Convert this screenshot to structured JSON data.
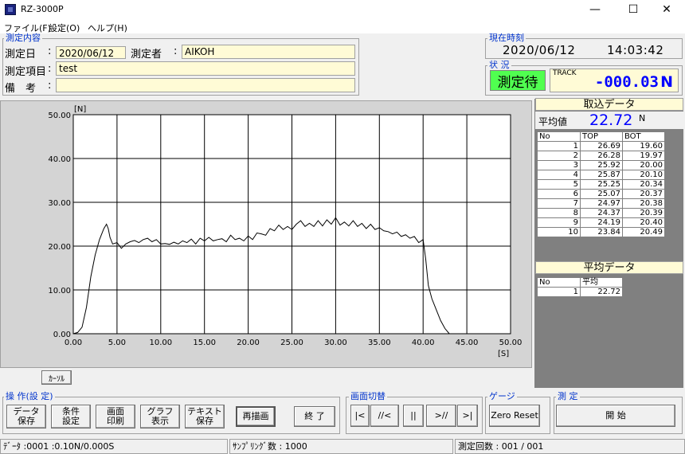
{
  "window": {
    "title": "RZ-3000P",
    "minimize": "—",
    "maximize": "☐",
    "close": "✕"
  },
  "menu": [
    "ファイル(F)",
    "設定(O)",
    "ヘルプ(H)"
  ],
  "measurement": {
    "group_label": "測定内容",
    "date_label": "測定日",
    "date_value": "2020/06/12",
    "operator_label": "測定者",
    "operator_value": "AIKOH",
    "item_label": "測定項目",
    "item_value": "test",
    "remarks_label": "備　考",
    "remarks_value": "",
    "colon": ":"
  },
  "clock": {
    "group_label": "現在時刻",
    "date": "2020/06/12",
    "time": "14:03:42"
  },
  "status": {
    "group_label": "状 況",
    "state": "測定待",
    "track_label": "TRACK",
    "track_value": "-000.03",
    "track_unit": "N",
    "colors": {
      "state_bg": "#50ff50",
      "track_fg": "#0000ff"
    }
  },
  "chart_data": {
    "type": "line",
    "title": "",
    "xlabel": "[S]",
    "ylabel": "[N]",
    "xlim": [
      0,
      50
    ],
    "ylim": [
      0,
      50
    ],
    "x_ticks": [
      "0.00",
      "5.00",
      "10.00",
      "15.00",
      "20.00",
      "25.00",
      "30.00",
      "35.00",
      "40.00",
      "45.00",
      "50.00"
    ],
    "y_ticks": [
      "0.00",
      "10.00",
      "20.00",
      "30.00",
      "40.00",
      "50.00"
    ],
    "grid": true,
    "series": [
      {
        "x": [
          0,
          0.5,
          1,
          1.5,
          2,
          2.5,
          3,
          3.5,
          3.8,
          4,
          4.2,
          4.5,
          5,
          5.5,
          6,
          6.5,
          7,
          7.5,
          8,
          8.5,
          9,
          9.5,
          10,
          10.5,
          11,
          11.5,
          12,
          12.5,
          13,
          13.5,
          14,
          14.5,
          15,
          15.5,
          16,
          16.5,
          17,
          17.5,
          18,
          18.5,
          19,
          19.5,
          20,
          20.5,
          21,
          21.5,
          22,
          22.5,
          23,
          23.5,
          24,
          24.5,
          25,
          25.5,
          26,
          26.5,
          27,
          27.5,
          28,
          28.5,
          29,
          29.5,
          30,
          30.5,
          31,
          31.5,
          32,
          32.5,
          33,
          33.5,
          34,
          34.5,
          35,
          35.5,
          36,
          36.5,
          37,
          37.5,
          38,
          38.5,
          39,
          39.5,
          40,
          40.3,
          40.6,
          41,
          41.5,
          42,
          42.5,
          43
        ],
        "y": [
          0,
          0.3,
          1.5,
          6,
          13,
          18,
          21.5,
          24,
          25,
          24,
          22,
          20.5,
          20.8,
          19.5,
          20.5,
          21,
          21.3,
          20.8,
          21.5,
          21.8,
          21,
          21.5,
          20.5,
          20.6,
          20.4,
          20.9,
          20.5,
          21.2,
          20.8,
          21.6,
          20.5,
          21.8,
          21.2,
          22,
          21.2,
          21.5,
          21.7,
          21,
          22.5,
          21.5,
          21.8,
          21.2,
          22.3,
          21.5,
          23,
          22.8,
          22.5,
          24,
          23.5,
          24.8,
          23.8,
          24.5,
          23.8,
          25,
          25.8,
          24.5,
          25.2,
          24.5,
          25.8,
          24.6,
          26,
          25,
          26.5,
          24.8,
          25.5,
          24.6,
          25.8,
          24.5,
          25.2,
          24,
          25,
          23.8,
          24.2,
          23.5,
          23.3,
          22.8,
          23.2,
          22.2,
          22.6,
          21.8,
          22.2,
          20.8,
          21.5,
          17,
          11,
          8,
          5.5,
          3,
          1.2,
          0
        ]
      }
    ]
  },
  "toriomi": {
    "header": "取込データ",
    "avg_label": "平均値",
    "avg_value": "22.72",
    "avg_unit": "N",
    "columns": [
      "No",
      "TOP",
      "BOT"
    ],
    "rows": [
      [
        "1",
        "26.69",
        "19.60"
      ],
      [
        "2",
        "26.28",
        "19.97"
      ],
      [
        "3",
        "25.92",
        "20.00"
      ],
      [
        "4",
        "25.87",
        "20.10"
      ],
      [
        "5",
        "25.25",
        "20.34"
      ],
      [
        "6",
        "25.07",
        "20.37"
      ],
      [
        "7",
        "24.97",
        "20.38"
      ],
      [
        "8",
        "24.37",
        "20.39"
      ],
      [
        "9",
        "24.19",
        "20.40"
      ],
      [
        "10",
        "23.84",
        "20.49"
      ]
    ]
  },
  "average_data": {
    "header": "平均データ",
    "columns": [
      "No",
      "平均"
    ],
    "rows": [
      [
        "1",
        "22.72"
      ]
    ]
  },
  "cursor_button": "ｶｰｿﾙ",
  "operations": {
    "group_label": "操 作(設 定)",
    "buttons": [
      {
        "l1": "データ",
        "l2": "保存"
      },
      {
        "l1": "条件",
        "l2": "設定"
      },
      {
        "l1": "画面",
        "l2": "印刷"
      },
      {
        "l1": "グラフ",
        "l2": "表示"
      },
      {
        "l1": "テキスト",
        "l2": "保存"
      }
    ],
    "redraw": "再描画",
    "exit": "終 了"
  },
  "screen_switch": {
    "group_label": "画面切替",
    "buttons": [
      "|<",
      "//<",
      "||",
      ">//",
      ">|"
    ]
  },
  "gauge": {
    "group_label": "ゲージ",
    "zero_reset": "Zero Reset"
  },
  "measure": {
    "group_label": "測 定",
    "start": "開 始"
  },
  "statusbar": {
    "data": "ﾃﾞｰﾀ :0001 :0.10N/0.000S",
    "sampling": "ｻﾝﾌﾟﾘﾝｸﾞ数 : 1000",
    "count": "測定回数 : 001 / 001"
  }
}
